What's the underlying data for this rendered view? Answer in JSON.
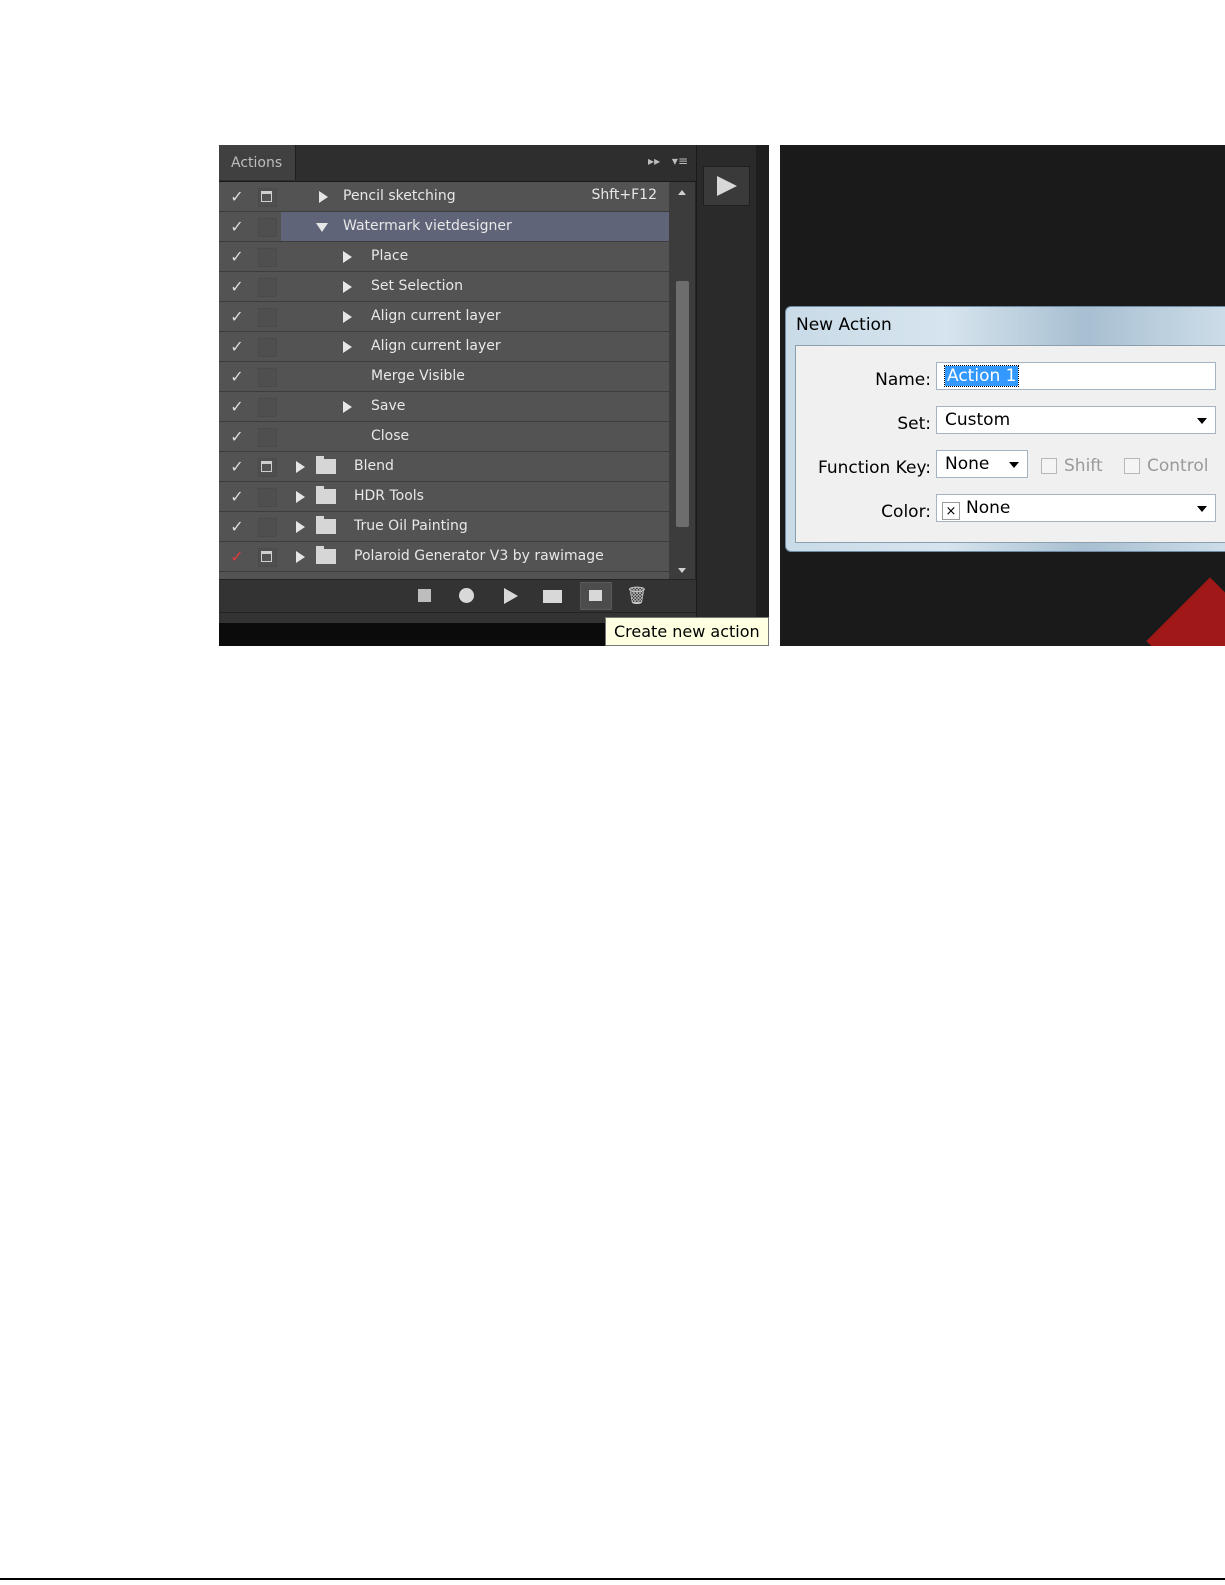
{
  "actions_panel": {
    "tab_label": "Actions",
    "header_icons": {
      "collapse": "▸▸",
      "menu": "▾≡"
    },
    "rows": [
      {
        "check": "✓",
        "check_color": "#dedede",
        "dialog_toggle": true,
        "kind": "action",
        "expand": "right",
        "label": "Pencil sketching",
        "shortcut": "Shft+F12"
      },
      {
        "check": "✓",
        "check_color": "#dedede",
        "dialog_toggle": false,
        "kind": "action",
        "expand": "down",
        "label": "Watermark vietdesigner",
        "selected": true
      },
      {
        "check": "✓",
        "check_color": "#dedede",
        "dialog_toggle": false,
        "kind": "command",
        "expand": "right",
        "label": "Place"
      },
      {
        "check": "✓",
        "check_color": "#dedede",
        "dialog_toggle": false,
        "kind": "command",
        "expand": "right",
        "label": "Set Selection"
      },
      {
        "check": "✓",
        "check_color": "#dedede",
        "dialog_toggle": false,
        "kind": "command",
        "expand": "right",
        "label": "Align current layer"
      },
      {
        "check": "✓",
        "check_color": "#dedede",
        "dialog_toggle": false,
        "kind": "command",
        "expand": "right",
        "label": "Align current layer"
      },
      {
        "check": "✓",
        "check_color": "#dedede",
        "dialog_toggle": false,
        "kind": "command",
        "expand": "none",
        "label": "Merge Visible"
      },
      {
        "check": "✓",
        "check_color": "#dedede",
        "dialog_toggle": false,
        "kind": "command",
        "expand": "right",
        "label": "Save"
      },
      {
        "check": "✓",
        "check_color": "#dedede",
        "dialog_toggle": false,
        "kind": "command",
        "expand": "none",
        "label": "Close"
      },
      {
        "check": "✓",
        "check_color": "#dedede",
        "dialog_toggle": true,
        "kind": "set",
        "expand": "right",
        "label": "Blend"
      },
      {
        "check": "✓",
        "check_color": "#dedede",
        "dialog_toggle": false,
        "kind": "set",
        "expand": "right",
        "label": "HDR Tools"
      },
      {
        "check": "✓",
        "check_color": "#dedede",
        "dialog_toggle": false,
        "kind": "set",
        "expand": "right",
        "label": "True Oil Painting"
      },
      {
        "check": "✓",
        "check_color": "#e03a3a",
        "dialog_toggle": true,
        "kind": "set",
        "expand": "right",
        "label": "Polaroid Generator V3 by rawimage"
      }
    ],
    "toolbar_icons": [
      "stop-icon",
      "record-icon",
      "play-icon",
      "folder-icon",
      "new-action-icon",
      "trash-icon"
    ],
    "trash_glyph": "🗑",
    "tooltip": "Create new action"
  },
  "new_action_dialog": {
    "title": "New Action",
    "name_label": "Name:",
    "name_value": "Action 1",
    "set_label": "Set:",
    "set_value": "Custom",
    "function_key_label": "Function Key:",
    "function_key_value": "None",
    "shift_label": "Shift",
    "control_label": "Control",
    "color_label": "Color:",
    "color_value": "None",
    "color_x": "×"
  }
}
